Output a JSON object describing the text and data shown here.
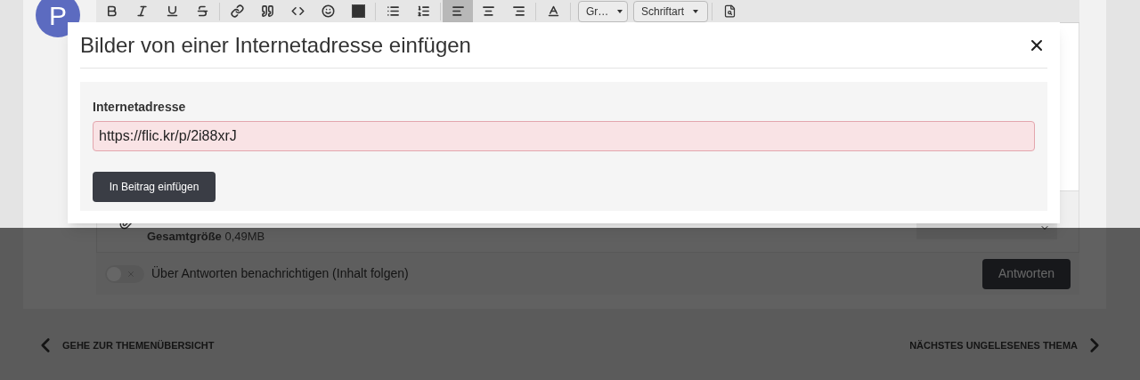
{
  "avatar": {
    "letter": "P"
  },
  "toolbar": {
    "tools": [
      {
        "selected": false
      },
      {
        "selected": false
      },
      {
        "selected": false
      },
      {
        "selected": false
      },
      {
        "selected": false
      },
      {
        "selected": false
      },
      {
        "selected": false
      },
      {
        "selected": false
      },
      {
        "selected": false
      },
      {
        "selected": false
      },
      {
        "selected": false
      },
      {
        "selected": true
      },
      {
        "selected": false
      },
      {
        "selected": false
      },
      {
        "selected": false
      }
    ],
    "dropdowns": [
      "Gr…",
      "Schriftart"
    ]
  },
  "attachments": {
    "total_label": "Gesamtgröße",
    "total_value": "0,49MB"
  },
  "notify": {
    "on": false,
    "label": "Über Antworten benachrichtigen (Inhalt folgen)"
  },
  "reply_button": "Antworten",
  "footer": {
    "back": "GEHE ZUR THEMENÜBERSICHT",
    "next": "NÄCHSTES UNGELESENES THEMA"
  },
  "dialog": {
    "title": "Bilder von einer Internetadresse einfügen",
    "field_label": "Internetadresse",
    "value": "https://flic.kr/p/2i88xrJ",
    "invalid": true,
    "submit": "In Beitrag einfügen"
  }
}
